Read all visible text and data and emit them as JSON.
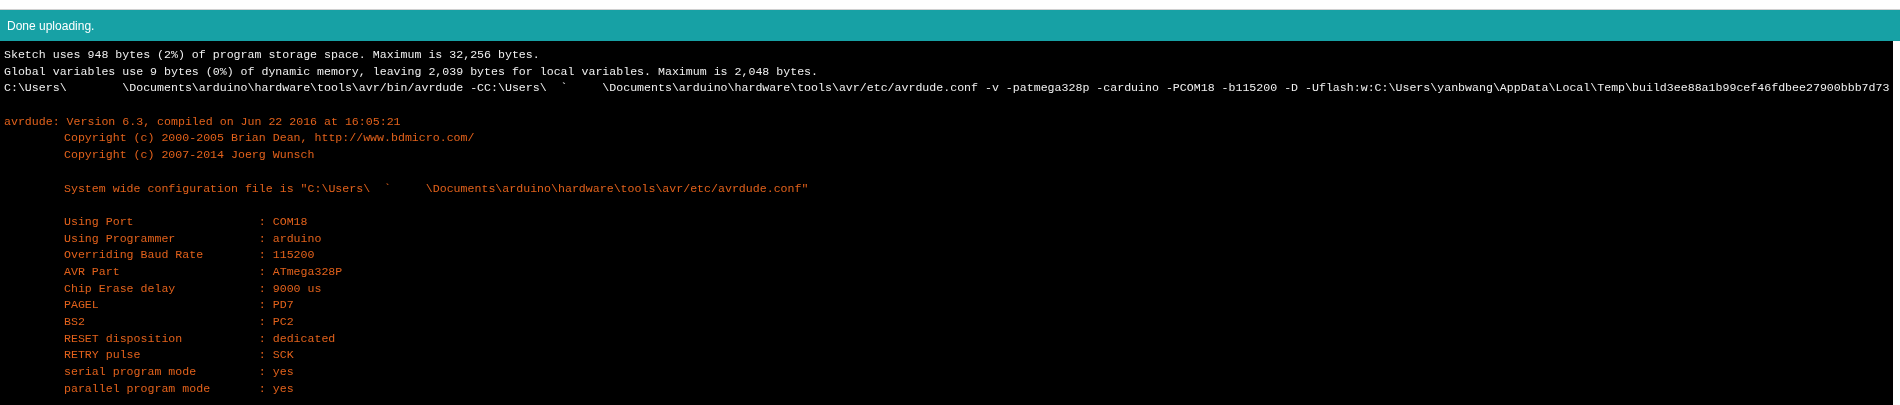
{
  "status_bar": {
    "message": "Done uploading."
  },
  "console": {
    "lines": [
      {
        "kind": "info",
        "text": "Sketch uses 948 bytes (2%) of program storage space. Maximum is 32,256 bytes."
      },
      {
        "kind": "info",
        "text": "Global variables use 9 bytes (0%) of dynamic memory, leaving 2,039 bytes for local variables. Maximum is 2,048 bytes."
      },
      {
        "kind": "info",
        "text": "C:\\Users\\        \\Documents\\arduino\\hardware\\tools\\avr/bin/avrdude -CC:\\Users\\  `     \\Documents\\arduino\\hardware\\tools\\avr/etc/avrdude.conf -v -patmega328p -carduino -PCOM18 -b115200 -D -Uflash:w:C:\\Users\\yanbwang\\AppData\\Local\\Temp\\build3ee88a1b99cef46fdbee27900bbb7d73"
      },
      {
        "kind": "blank"
      },
      {
        "kind": "error",
        "text": "avrdude: Version 6.3, compiled on Jun 22 2016 at 16:05:21"
      },
      {
        "kind": "detail",
        "text": "Copyright (c) 2000-2005 Brian Dean, http://www.bdmicro.com/"
      },
      {
        "kind": "detail",
        "text": "Copyright (c) 2007-2014 Joerg Wunsch"
      },
      {
        "kind": "blank"
      },
      {
        "kind": "detail",
        "text": "System wide configuration file is \"C:\\Users\\  `     \\Documents\\arduino\\hardware\\tools\\avr/etc/avrdude.conf\""
      },
      {
        "kind": "blank"
      },
      {
        "kind": "field",
        "key": "Using Port",
        "value": ": COM18"
      },
      {
        "kind": "field",
        "key": "Using Programmer",
        "value": ": arduino"
      },
      {
        "kind": "field",
        "key": "Overriding Baud Rate",
        "value": ": 115200"
      },
      {
        "kind": "field",
        "key": "AVR Part",
        "value": ": ATmega328P"
      },
      {
        "kind": "field",
        "key": "Chip Erase delay",
        "value": ": 9000 us"
      },
      {
        "kind": "field",
        "key": "PAGEL",
        "value": ": PD7"
      },
      {
        "kind": "field",
        "key": "BS2",
        "value": ": PC2"
      },
      {
        "kind": "field",
        "key": "RESET disposition",
        "value": ": dedicated"
      },
      {
        "kind": "field",
        "key": "RETRY pulse",
        "value": ": SCK"
      },
      {
        "kind": "field",
        "key": "serial program mode",
        "value": ": yes"
      },
      {
        "kind": "field",
        "key": "parallel program mode",
        "value": ": yes"
      }
    ]
  }
}
